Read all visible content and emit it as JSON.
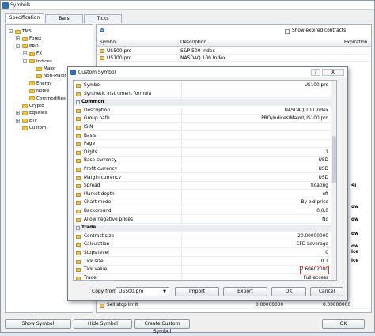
{
  "window": {
    "title": "Symbols",
    "ok_label": "OK"
  },
  "tabs": [
    "Specification",
    "Bars",
    "Ticks"
  ],
  "tree": [
    {
      "label": "TMS",
      "depth": 0,
      "exp": "-"
    },
    {
      "label": "Forex",
      "depth": 1,
      "exp": "+"
    },
    {
      "label": "PRO",
      "depth": 1,
      "exp": "-"
    },
    {
      "label": "FX",
      "depth": 2,
      "exp": "+"
    },
    {
      "label": "Indices",
      "depth": 2,
      "exp": "-"
    },
    {
      "label": "Major",
      "depth": 3,
      "exp": ""
    },
    {
      "label": "Non-Major",
      "depth": 3,
      "exp": ""
    },
    {
      "label": "Energy",
      "depth": 2,
      "exp": ""
    },
    {
      "label": "Noble",
      "depth": 2,
      "exp": ""
    },
    {
      "label": "Commodities",
      "depth": 2,
      "exp": ""
    },
    {
      "label": "Crypto",
      "depth": 1,
      "exp": ""
    },
    {
      "label": "Equities",
      "depth": 1,
      "exp": "+"
    },
    {
      "label": "ETF",
      "depth": 1,
      "exp": "+"
    },
    {
      "label": "Custom",
      "depth": 1,
      "exp": ""
    }
  ],
  "right_panel": {
    "show_expired_label": "Show expired contracts",
    "columns": {
      "symbol": "Symbol",
      "description": "Description",
      "expiration": "Expiration"
    },
    "rows": [
      {
        "symbol": "US500.pro",
        "description": "S&P 500 Index"
      },
      {
        "symbol": "US100.pro",
        "description": "NASDAQ 100 Index"
      }
    ],
    "peek_rows": [
      "SL",
      "ow",
      "ow",
      "ow",
      "ow",
      "ice",
      "ice"
    ],
    "sell_stop": {
      "label": "Sell stop limit",
      "value": "0.00000000",
      "mode": "0.00000000"
    }
  },
  "bottom_buttons": [
    "Show Symbol",
    "Hide Symbol",
    "Create Custom Symbol"
  ],
  "dialog": {
    "title": "Custom Symbol",
    "title_btn_help": "?",
    "title_btn_close": "X",
    "properties": [
      {
        "type": "row",
        "name": "Symbol",
        "value": "US100.pro"
      },
      {
        "type": "row",
        "name": "Synthetic instrument formula",
        "value": ""
      },
      {
        "type": "section",
        "name": "Common"
      },
      {
        "type": "row",
        "name": "Description",
        "value": "NASDAQ 100 Index"
      },
      {
        "type": "row",
        "name": "Group path",
        "value": "PRO\\Indices\\Major\\US100.pro"
      },
      {
        "type": "row",
        "name": "ISIN",
        "value": ""
      },
      {
        "type": "row",
        "name": "Basis",
        "value": ""
      },
      {
        "type": "row",
        "name": "Page",
        "value": ""
      },
      {
        "type": "row",
        "name": "Digits",
        "value": "1"
      },
      {
        "type": "row",
        "name": "Base currency",
        "value": "USD"
      },
      {
        "type": "row",
        "name": "Profit currency",
        "value": "USD"
      },
      {
        "type": "row",
        "name": "Margin currency",
        "value": "USD"
      },
      {
        "type": "row",
        "name": "Spread",
        "value": "floating"
      },
      {
        "type": "row",
        "name": "Market depth",
        "value": "off"
      },
      {
        "type": "row",
        "name": "Chart mode",
        "value": "By bid price"
      },
      {
        "type": "row",
        "name": "Background",
        "value": "0,0,0"
      },
      {
        "type": "row",
        "name": "Allow negative prices",
        "value": "No"
      },
      {
        "type": "section",
        "name": "Trade"
      },
      {
        "type": "row",
        "name": "Contract size",
        "value": "20.00000000"
      },
      {
        "type": "row",
        "name": "Calculation",
        "value": "CFD Leverage"
      },
      {
        "type": "row",
        "name": "Stops level",
        "value": "0"
      },
      {
        "type": "row",
        "name": "Tick size",
        "value": "0.1"
      },
      {
        "type": "row",
        "name": "Tick value",
        "value": "7.60602000",
        "highlight": true
      },
      {
        "type": "row",
        "name": "Trade",
        "value": "Full access"
      }
    ],
    "copy_from_label": "Copy from:",
    "copy_from_value": "US500.pro",
    "buttons": [
      "Import",
      "Export",
      "OK",
      "Cancel"
    ]
  }
}
